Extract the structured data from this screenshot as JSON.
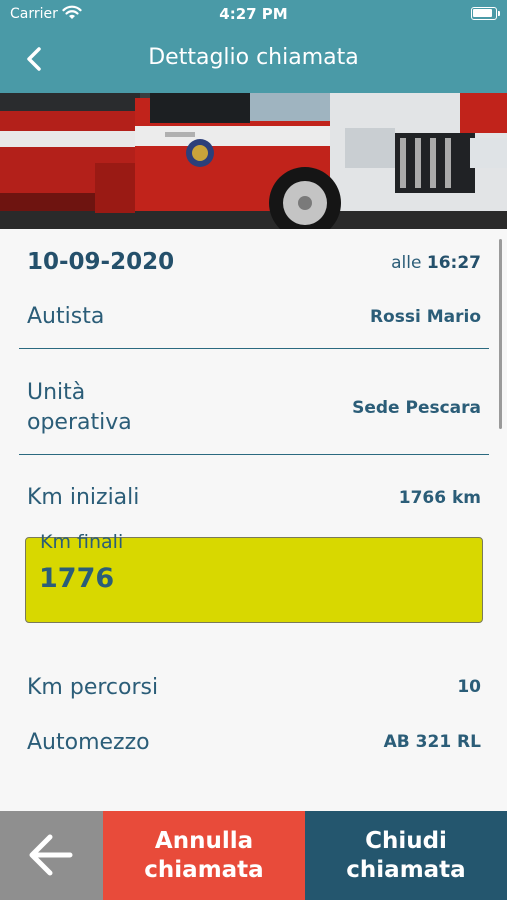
{
  "status_bar": {
    "carrier": "Carrier",
    "time": "4:27 PM"
  },
  "nav": {
    "title": "Dettaglio chiamata"
  },
  "call": {
    "date": "10-09-2020",
    "time_prefix": "alle",
    "time": "16:27",
    "driver_label": "Autista",
    "driver_value": "Rossi Mario",
    "unit_label": "Unità operativa",
    "unit_value": "Sede Pescara",
    "km_start_label": "Km iniziali",
    "km_start_value": "1766 km",
    "km_end_label": "Km finali",
    "km_end_value": "1776",
    "km_travelled_label": "Km percorsi",
    "km_travelled_value": "10",
    "vehicle_label": "Automezzo",
    "vehicle_value": "AB 321 RL"
  },
  "actions": {
    "cancel_label": "Annulla chiamata",
    "close_label": "Chiudi chiamata"
  },
  "colors": {
    "header": "#4a9aa7",
    "cancel": "#e84b3a",
    "close": "#24566e",
    "back": "#8f8f8f",
    "field_highlight": "#d8d800"
  }
}
